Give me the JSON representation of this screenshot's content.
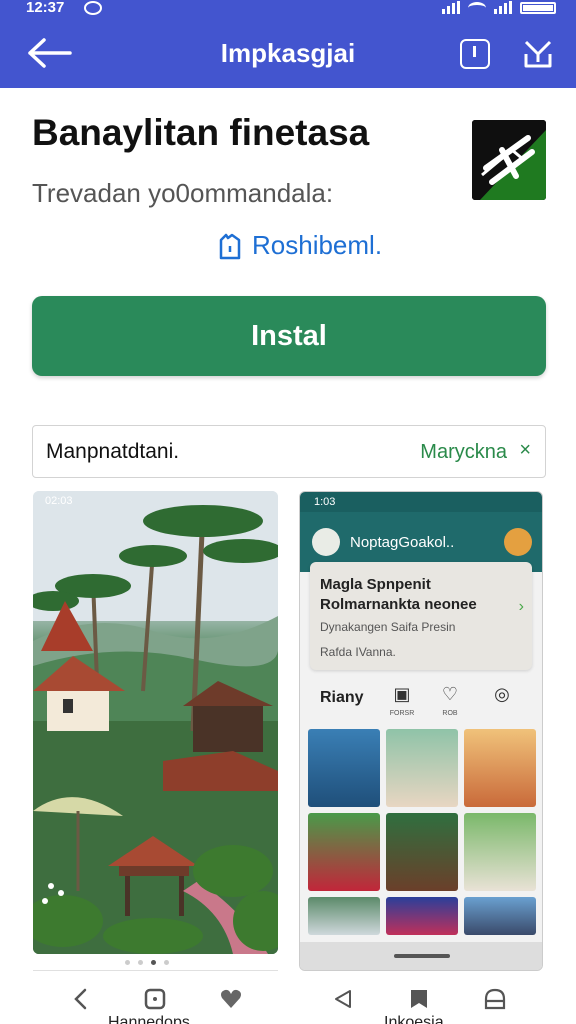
{
  "status_bar": {
    "time": "12:37"
  },
  "app_bar": {
    "title": "Impkasgjai",
    "back_icon": "arrow-left-icon",
    "action_icons": [
      "info-square-icon",
      "share-icon"
    ]
  },
  "app": {
    "title": "Banaylitan finetasa",
    "subtitle": "Trevadan yo0ommandala:",
    "developer_link": "Roshibeml.",
    "icon": "app-logo-icon"
  },
  "install_button": {
    "label": "Instal"
  },
  "banner": {
    "label": "Manpnatdtani.",
    "link": "Maryckna",
    "close": "×"
  },
  "screenshot_1": {
    "status_time": "02:03"
  },
  "screenshot_2": {
    "status_time": "1:03",
    "app_name": "NoptagGoakol..",
    "card_line_1": "Magla Spnpenit",
    "card_line_2": "Rolmarnankta neonee",
    "card_line_3": "Dynakangen Saifa Presin",
    "card_line_4": "Rafda IVanna.",
    "section_label": "Riany",
    "icon_labels": [
      "FORSR",
      "ROB",
      ""
    ]
  },
  "bottom_nav": {
    "label_left": "Hannedops",
    "label_right": "Inkoesia"
  },
  "colors": {
    "app_bar": "#4355cf",
    "install": "#2a8a5a",
    "link": "#1e6fd4",
    "banner_link": "#2a8a4a"
  }
}
